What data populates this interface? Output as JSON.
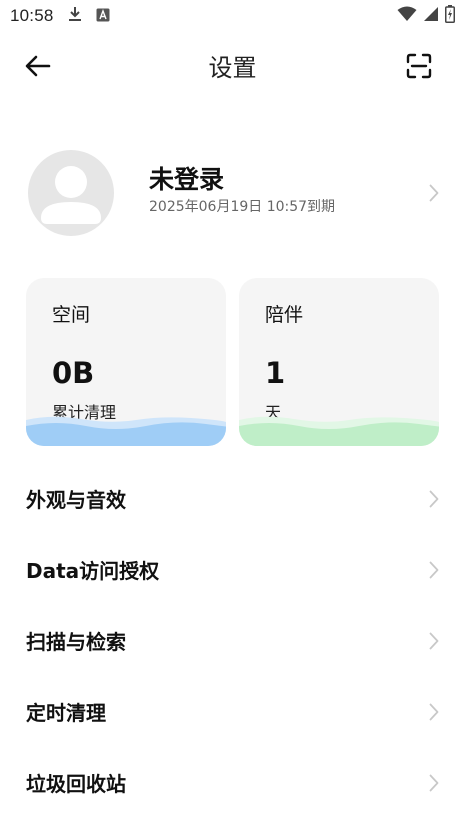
{
  "status_bar": {
    "time": "10:58",
    "icons_left": [
      "download-icon",
      "a-badge-icon"
    ],
    "icons_right": [
      "wifi-icon",
      "signal-icon",
      "battery-icon"
    ]
  },
  "header": {
    "title": "设置",
    "back_icon": "back-arrow-icon",
    "scan_icon": "scan-icon"
  },
  "profile": {
    "name": "未登录",
    "expire": "2025年06月19日 10:57到期"
  },
  "cards": {
    "space": {
      "title": "空间",
      "value": "0B",
      "sub": "累计清理",
      "wave_color": "#9fcdf6"
    },
    "companion": {
      "title": "陪伴",
      "value": "1",
      "sub": "天",
      "wave_color": "#bfeec8"
    }
  },
  "menu": [
    {
      "label": "外观与音效"
    },
    {
      "label": "Data访问授权"
    },
    {
      "label": "扫描与检索"
    },
    {
      "label": "定时清理"
    },
    {
      "label": "垃圾回收站"
    }
  ],
  "colors": {
    "background": "#ffffff",
    "card_bg": "#f5f5f5",
    "chevron": "#c8c8c8",
    "avatar_bg": "#e6e6e6"
  }
}
